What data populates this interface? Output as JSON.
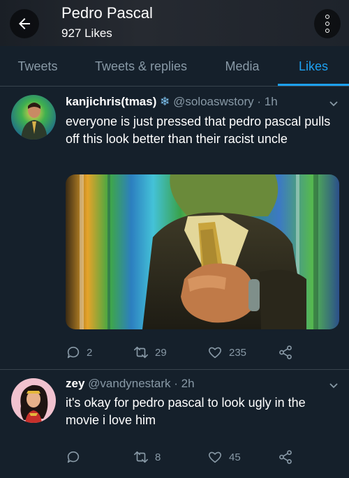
{
  "header": {
    "title": "Pedro Pascal",
    "subtitle": "927 Likes"
  },
  "tabs": [
    {
      "label": "Tweets"
    },
    {
      "label": "Tweets & replies"
    },
    {
      "label": "Media"
    },
    {
      "label": "Likes"
    }
  ],
  "tweets": [
    {
      "name": "kanjichris(tmas)",
      "name_emoji": "❄",
      "handle": "@soloaswstory",
      "time": "· 1h",
      "text": "everyone is just pressed that pedro pascal pulls off this look better than their racist uncle",
      "media": "photo",
      "replies": "2",
      "retweets": "29",
      "likes": "235"
    },
    {
      "name": "zey",
      "handle": "@vandynestark",
      "time": "· 2h",
      "text": "it's okay for pedro pascal to look ugly in the movie i love him",
      "replies": "",
      "retweets": "8",
      "likes": "45"
    }
  ],
  "colors": {
    "background": "#15202b",
    "accent": "#1da1f2",
    "muted": "#8899a6",
    "divider": "#38444d"
  }
}
